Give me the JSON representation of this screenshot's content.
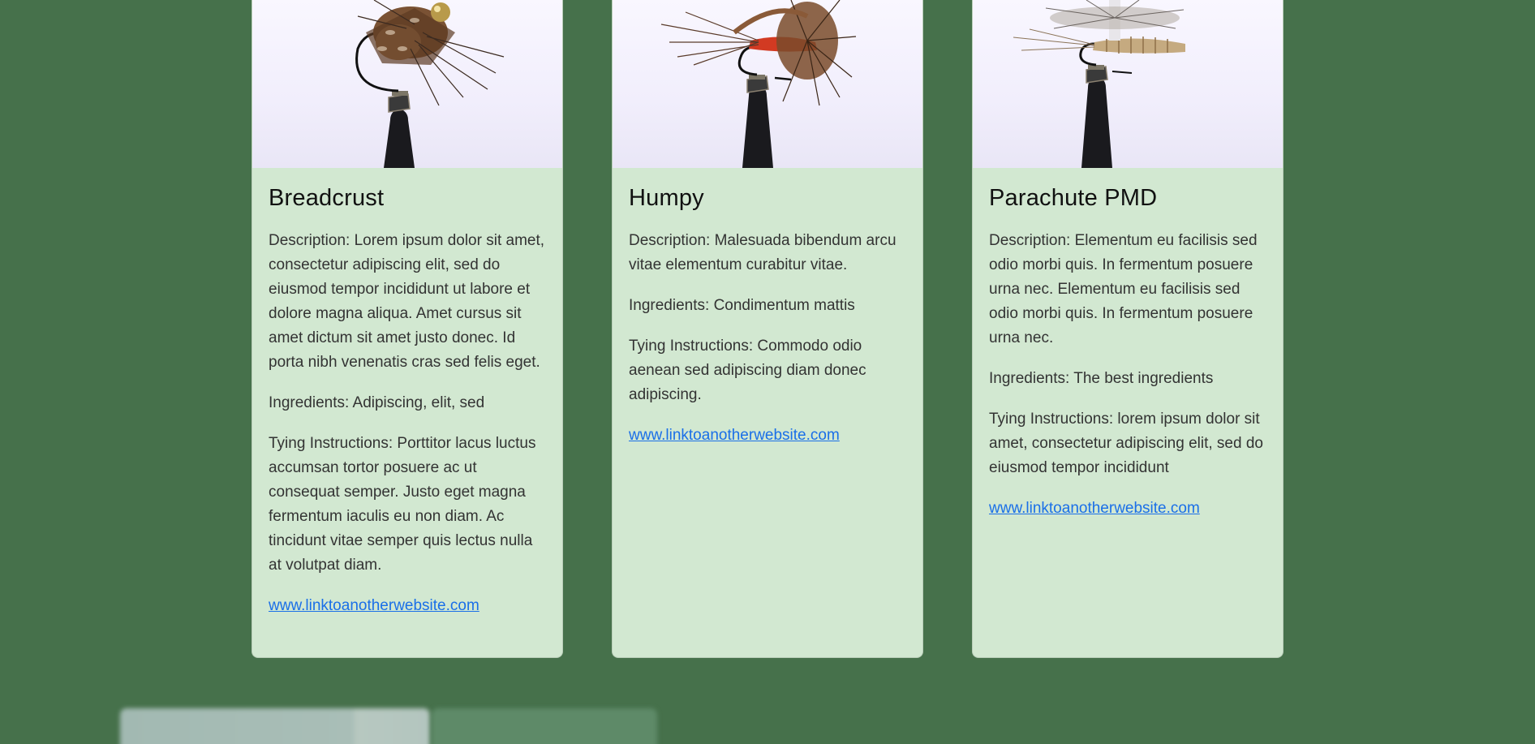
{
  "cards": [
    {
      "title": "Breadcrust",
      "description": "Description: Lorem ipsum dolor sit amet, consectetur adipiscing elit, sed do eiusmod tempor incididunt ut labore et dolore magna aliqua. Amet cursus sit amet dictum sit amet justo donec. Id porta nibh venenatis cras sed felis eget.",
      "ingredients": "Ingredients: Adipiscing, elit, sed",
      "tying": "Tying Instructions: Porttitor lacus luctus accumsan tortor posuere ac ut consequat semper. Justo eget magna fermentum iaculis eu non diam. Ac tincidunt vitae semper quis lectus nulla at volutpat diam.",
      "link": "www.linktoanotherwebsite.com",
      "image": "fly-breadcrust-photo"
    },
    {
      "title": "Humpy",
      "description": "Description: Malesuada bibendum arcu vitae elementum curabitur vitae.",
      "ingredients": "Ingredients: Condimentum mattis",
      "tying": "Tying Instructions: Commodo odio aenean sed adipiscing diam donec adipiscing.",
      "link": "www.linktoanotherwebsite.com",
      "image": "fly-humpy-photo"
    },
    {
      "title": "Parachute PMD",
      "description": "Description: Elementum eu facilisis sed odio morbi quis. In fermentum posuere urna nec. Elementum eu facilisis sed odio morbi quis. In fermentum posuere urna nec.",
      "ingredients": "Ingredients: The best ingredients",
      "tying": "Tying Instructions: lorem ipsum dolor sit amet, consectetur adipiscing elit, sed do eiusmod tempor incididunt",
      "link": "www.linktoanotherwebsite.com",
      "image": "fly-parachute-pmd-photo"
    }
  ],
  "colors": {
    "background": "#46714b",
    "card": "#d2e8d1",
    "link": "#1a6fe8",
    "title": "#111111",
    "text": "#333333"
  }
}
